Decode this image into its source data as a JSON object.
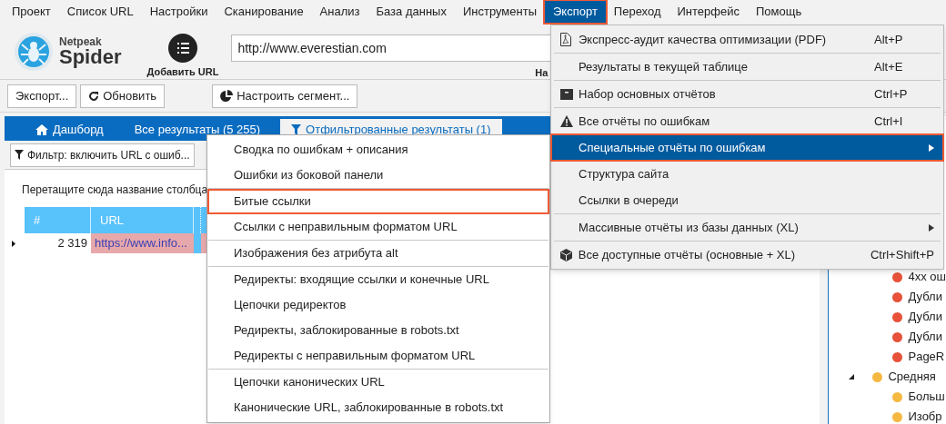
{
  "menubar": [
    {
      "label": "Проект",
      "selected": false
    },
    {
      "label": "Список URL",
      "selected": false
    },
    {
      "label": "Настройки",
      "selected": false
    },
    {
      "label": "Сканирование",
      "selected": false
    },
    {
      "label": "Анализ",
      "selected": false
    },
    {
      "label": "База данных",
      "selected": false
    },
    {
      "label": "Инструменты",
      "selected": false
    },
    {
      "label": "Экспорт",
      "selected": true
    },
    {
      "label": "Переход",
      "selected": false
    },
    {
      "label": "Интерфейс",
      "selected": false
    },
    {
      "label": "Помощь",
      "selected": false
    }
  ],
  "logo": {
    "line_1": "Netpeak",
    "line_2": "Spider"
  },
  "add_url_button": "Добавить URL",
  "url_field": {
    "value": "http://www.everestian.com"
  },
  "url_field_caption": "На",
  "toolbar": [
    {
      "label": "Экспорт...",
      "kind": "plain"
    },
    {
      "label": "Обновить",
      "kind": "refresh"
    },
    {
      "label": "Настроить сегмент...",
      "kind": "pie"
    }
  ],
  "tabs": [
    {
      "label": "Дашборд",
      "kind": "home",
      "selected": false
    },
    {
      "label": "Все результаты (5 255)",
      "kind": "plain",
      "selected": false
    },
    {
      "label": "Отфильтрованные результаты (1)",
      "kind": "filter",
      "selected": true
    }
  ],
  "filter_button": "Фильтр: включить URL с ошиб...",
  "group_hint": "Перетащите сюда название столбца",
  "table": {
    "columns": [
      "#",
      "URL"
    ],
    "rows": [
      {
        "number": "2 319",
        "url": "https://www.info..."
      }
    ]
  },
  "tree": [
    {
      "children": [
        {
          "label": "4xx ош",
          "color": "#e8523a"
        },
        {
          "label": "Дубли",
          "color": "#e8523a"
        },
        {
          "label": "Дубли",
          "color": "#e8523a"
        },
        {
          "label": "Дубли",
          "color": "#e8523a"
        },
        {
          "label": "PageR",
          "color": "#e8523a"
        }
      ]
    },
    {
      "label": "Средняя",
      "color": "#f5b942",
      "expanded": true,
      "children": [
        {
          "label": "Больш",
          "color": "#f5b942"
        },
        {
          "label": "Изобр",
          "color": "#f5b942"
        }
      ]
    }
  ],
  "export_menu": {
    "groups": [
      [
        {
          "label": "Экспресс-аудит качества оптимизации (PDF)",
          "shortcut": "Alt+P",
          "kind": "pdf",
          "submenu": false,
          "selected": false
        }
      ],
      [
        {
          "label": "Результаты в текущей таблице",
          "shortcut": "Alt+E",
          "kind": "plain",
          "submenu": false,
          "selected": false
        }
      ],
      [
        {
          "label": "Набор основных отчётов",
          "shortcut": "Ctrl+P",
          "kind": "box",
          "submenu": false,
          "selected": false
        }
      ],
      [
        {
          "label": "Все отчёты по ошибкам",
          "shortcut": "Ctrl+I",
          "kind": "warning",
          "submenu": false,
          "selected": false
        },
        {
          "label": "Специальные отчёты по ошибкам",
          "kind": "plain",
          "submenu": true,
          "selected": true
        },
        {
          "label": "Структура сайта",
          "kind": "plain",
          "submenu": false,
          "selected": false
        },
        {
          "label": "Ссылки в очереди",
          "kind": "plain",
          "submenu": false,
          "selected": false
        }
      ],
      [
        {
          "label": "Массивные отчёты из базы данных (XL)",
          "kind": "plain",
          "submenu": true,
          "selected": false
        }
      ],
      [
        {
          "label": "Все доступные отчёты (основные + XL)",
          "shortcut": "Ctrl+Shift+P",
          "kind": "cube",
          "submenu": false,
          "selected": false
        }
      ]
    ]
  },
  "submenu": {
    "groups": [
      [
        {
          "label": "Сводка по ошибкам + описания",
          "highlighted": false
        },
        {
          "label": "Ошибки из боковой панели",
          "highlighted": false
        }
      ],
      [
        {
          "label": "Битые ссылки",
          "highlighted": true
        },
        {
          "label": "Ссылки с неправильным форматом URL",
          "highlighted": false
        }
      ],
      [
        {
          "label": "Изображения без атрибута alt",
          "highlighted": false
        }
      ],
      [
        {
          "label": "Редиректы: входящие ссылки и конечные URL",
          "highlighted": false
        },
        {
          "label": "Цепочки редиректов",
          "highlighted": false
        },
        {
          "label": "Редиректы, заблокированные в robots.txt",
          "highlighted": false
        },
        {
          "label": "Редиректы с неправильным форматом URL",
          "highlighted": false
        }
      ],
      [
        {
          "label": "Цепочки канонических URL",
          "highlighted": false
        },
        {
          "label": "Канонические URL, заблокированные в robots.txt",
          "highlighted": false
        }
      ]
    ]
  }
}
